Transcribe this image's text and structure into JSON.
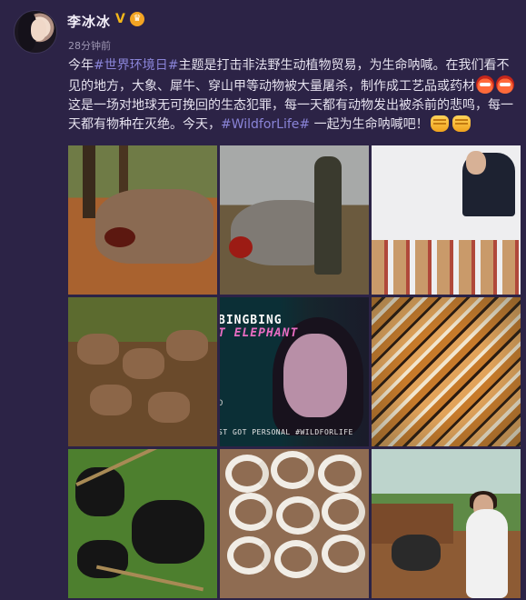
{
  "user": {
    "name": "李冰冰",
    "verified_badge": "V",
    "time": "28分钟前"
  },
  "post": {
    "segments": [
      {
        "type": "text",
        "text": "今年"
      },
      {
        "type": "tag",
        "text": "#世界环境日#"
      },
      {
        "type": "text",
        "text": "主题是打击非法野生动植物贸易，为生命呐喊。在我们看不见的地方，大象、犀牛、穿山甲等动物被大量屠杀，制作成工艺品或药材"
      },
      {
        "type": "emoji",
        "name": "angry-emoji"
      },
      {
        "type": "emoji",
        "name": "angry-emoji"
      },
      {
        "type": "text",
        "text": "这是一场对地球无可挽回的生态犯罪，每一天都有动物发出被杀前的悲鸣，每一天都有物种在灭绝。今天，"
      },
      {
        "type": "tag",
        "text": "#WildforLife#"
      },
      {
        "type": "text",
        "text": " 一起为生命呐喊吧！"
      },
      {
        "type": "emoji",
        "name": "fist-emoji"
      },
      {
        "type": "emoji",
        "name": "fist-emoji"
      }
    ]
  },
  "images": {
    "poster_title_line1": "BINGBING",
    "poster_title_line2": "T ELEPHANT",
    "poster_side_text": "D",
    "poster_footer": "ST GOT PERSONAL  #WILDFORLIFE"
  }
}
